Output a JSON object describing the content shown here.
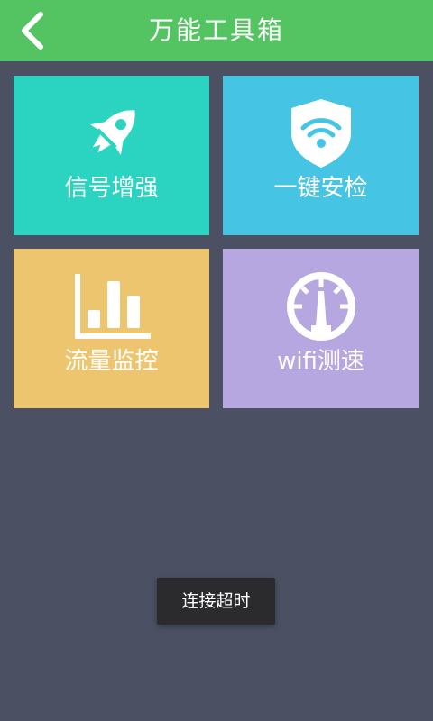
{
  "header": {
    "title": "万能工具箱",
    "back_icon": "chevron-left-icon",
    "color": "#54c361"
  },
  "tiles": [
    {
      "label": "信号增强",
      "icon": "rocket-icon",
      "color": "#2bd4c1"
    },
    {
      "label": "一键安检",
      "icon": "wifi-shield-icon",
      "color": "#45c4e3"
    },
    {
      "label": "流量监控",
      "icon": "bar-chart-icon",
      "color": "#ecc56e"
    },
    {
      "label": "wifi测速",
      "icon": "speedometer-icon",
      "color": "#b7a7e1"
    }
  ],
  "toast": {
    "message": "连接超时"
  },
  "colors": {
    "background": "#4b5163"
  }
}
